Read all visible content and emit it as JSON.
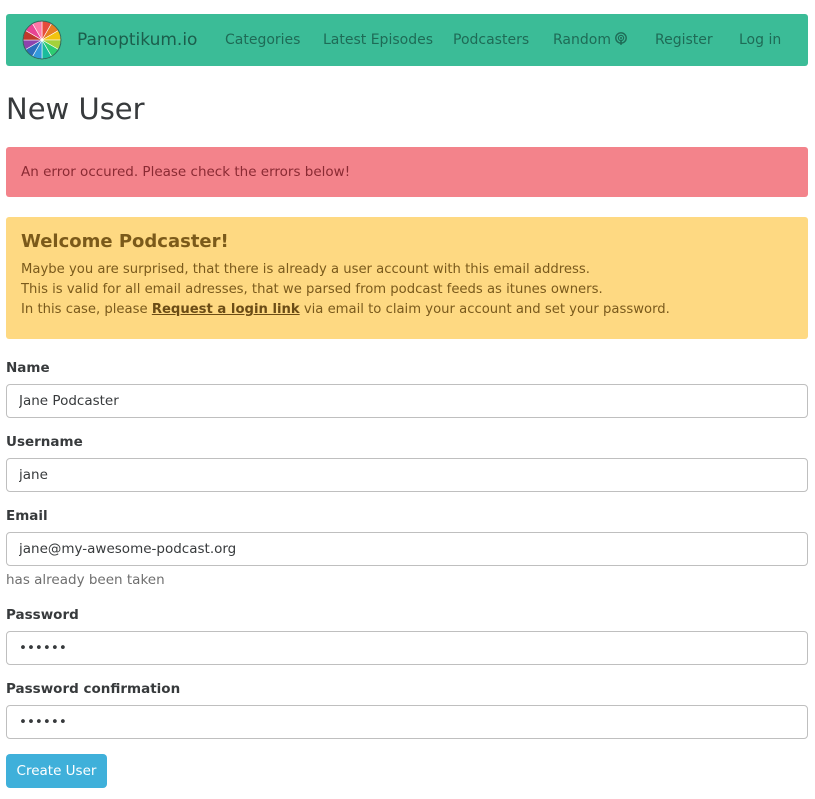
{
  "navbar": {
    "brand": "Panoptikum.io",
    "items": [
      {
        "label": "Categories"
      },
      {
        "label": "Latest Episodes"
      },
      {
        "label": "Podcasters"
      },
      {
        "label": "Random"
      },
      {
        "label": "Register"
      },
      {
        "label": "Log in"
      }
    ],
    "accent_color": "#3bbc97"
  },
  "page": {
    "title": "New User"
  },
  "error_alert": {
    "text": "An error occured. Please check the errors below!",
    "color": "#f3838b"
  },
  "welcome_alert": {
    "heading": "Welcome Podcaster!",
    "line1": "Maybe you are surprised, that there is already a user account with this email address.",
    "line2": "This is valid for all email adresses, that we parsed from podcast feeds as itunes owners.",
    "line3_prefix": "In this case, please ",
    "link": "Request a login link",
    "line3_suffix": " via email to claim your account and set your password.",
    "color": "#fed982"
  },
  "form": {
    "name": {
      "label": "Name",
      "value": "Jane Podcaster"
    },
    "username": {
      "label": "Username",
      "value": "jane"
    },
    "email": {
      "label": "Email",
      "value": "jane@my-awesome-podcast.org",
      "error": "has already been taken"
    },
    "password": {
      "label": "Password",
      "value": "••••••"
    },
    "password_confirmation": {
      "label": "Password confirmation",
      "value": "••••••"
    },
    "submit_label": "Create User",
    "submit_color": "#3fb0da"
  },
  "icons": {
    "logo": "color-wheel-logo",
    "random": "podcast-icon"
  }
}
